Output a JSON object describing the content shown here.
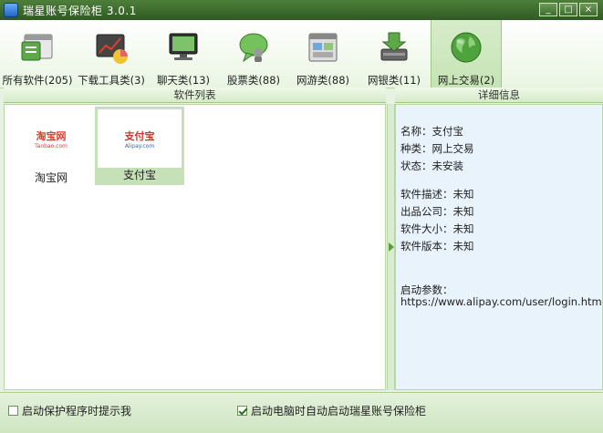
{
  "window": {
    "title": "瑞星账号保险柜 3.0.1",
    "minimize": "_",
    "maximize": "□",
    "close": "×"
  },
  "toolbar": {
    "items": [
      {
        "label": "所有软件(205)",
        "icon": "window-list-icon"
      },
      {
        "label": "下载工具类(3)",
        "icon": "download-chart-icon"
      },
      {
        "label": "聊天类(13)",
        "icon": "monitor-chat-icon"
      },
      {
        "label": "股票类(88)",
        "icon": "speech-bubble-icon"
      },
      {
        "label": "网游类(88)",
        "icon": "game-window-icon"
      },
      {
        "label": "网银类(11)",
        "icon": "bank-arrow-icon"
      },
      {
        "label": "网上交易(2)",
        "icon": "globe-icon"
      }
    ],
    "active_index": 6
  },
  "left_pane": {
    "header": "软件列表",
    "items": [
      {
        "name": "淘宝网",
        "logo_text": "淘宝网",
        "logo_sub": "Taobao.com",
        "selected": false
      },
      {
        "name": "支付宝",
        "logo_text": "支付宝",
        "logo_sub": "Alipay.com",
        "selected": true
      }
    ]
  },
  "right_pane": {
    "header": "详细信息",
    "name_line": "名称：支付宝",
    "type_line": "种类：网上交易",
    "status_line": "状态：未安装",
    "desc_line": "软件描述：未知",
    "company_line": "出品公司：未知",
    "size_line": "软件大小：未知",
    "version_line": "软件版本：未知",
    "params_label": "启动参数：",
    "params_value": "https://www.alipay.com/user/login.htm"
  },
  "footer": {
    "prompt_label": "启动保护程序时提示我",
    "prompt_checked": false,
    "autostart_label": "启动电脑时自动启动瑞星账号保险柜",
    "autostart_checked": true
  },
  "colors": {
    "accent_green": "#5e9b3f",
    "title_green": "#2f5a22",
    "detail_bg": "#e8f3fc"
  }
}
